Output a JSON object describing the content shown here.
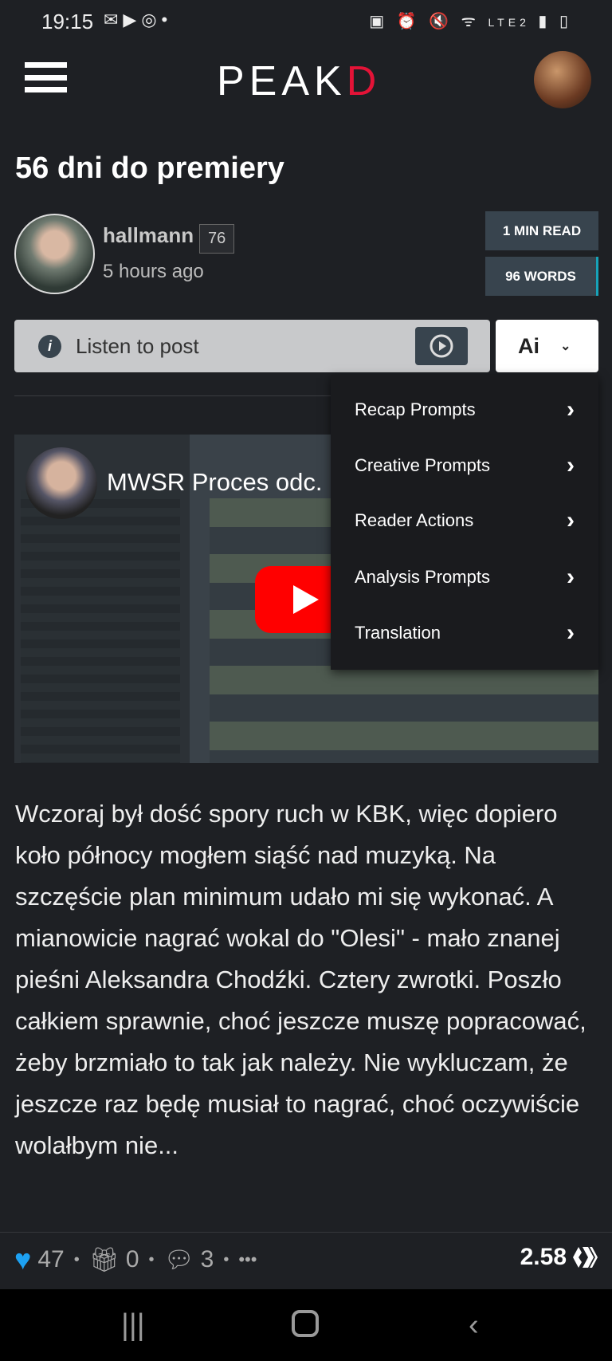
{
  "status_bar": {
    "time": "19:15",
    "network": "LTE2"
  },
  "header": {
    "logo": "PEAKD",
    "logo_accent": "#e31337"
  },
  "post": {
    "title": "56 dni do premiery",
    "author": "hallmann",
    "reputation": "76",
    "time_ago": "5 hours ago",
    "read_time": "1 MIN READ",
    "word_count": "96 WORDS",
    "listen_label": "Listen to post",
    "ai_label": "Ai",
    "video_title": "MWSR Proces odc.",
    "body": "Wczoraj był dość spory ruch w KBK, więc dopiero koło północy mogłem siąść nad muzyką. Na szczęście plan minimum udało mi się wykonać. A mianowicie nagrać wokal do \"Olesi\" - mało znanej pieśni Aleksandra Chodźki. Cztery zwrotki. Poszło całkiem sprawnie, choć jeszcze muszę popracować, żeby brzmiało to tak jak należy. Nie wykluczam, że jeszcze raz będę musiał to nagrać, choć oczywiście wolałbym nie..."
  },
  "ai_menu": {
    "items": [
      {
        "label": "Recap Prompts"
      },
      {
        "label": "Creative Prompts"
      },
      {
        "label": "Reader Actions"
      },
      {
        "label": "Analysis Prompts"
      },
      {
        "label": "Translation"
      }
    ]
  },
  "footer": {
    "votes": "47",
    "tips": "0",
    "comments": "3",
    "more": "•••",
    "payout": "2.58",
    "heart_color": "#1da1f2"
  }
}
